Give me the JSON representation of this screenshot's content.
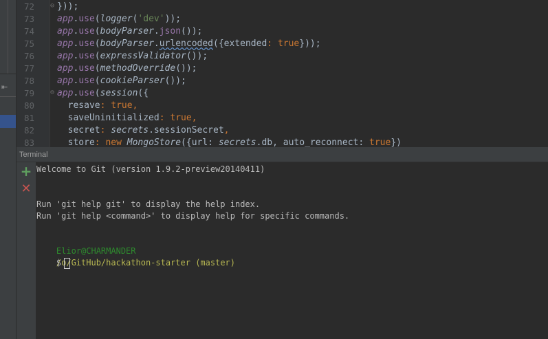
{
  "editor": {
    "lines": [
      {
        "num": "72",
        "tokens": [
          {
            "t": "})",
            "c": "plain"
          },
          {
            "t": ");",
            "c": "plain"
          }
        ]
      },
      {
        "num": "73",
        "tokens": [
          {
            "t": "app",
            "c": "obj"
          },
          {
            "t": ".",
            "c": "plain"
          },
          {
            "t": "use",
            "c": "prop"
          },
          {
            "t": "(",
            "c": "plain"
          },
          {
            "t": "logger",
            "c": "fn"
          },
          {
            "t": "(",
            "c": "plain"
          },
          {
            "t": "'dev'",
            "c": "str"
          },
          {
            "t": "));",
            "c": "plain"
          }
        ]
      },
      {
        "num": "74",
        "tokens": [
          {
            "t": "app",
            "c": "obj"
          },
          {
            "t": ".",
            "c": "plain"
          },
          {
            "t": "use",
            "c": "prop"
          },
          {
            "t": "(",
            "c": "plain"
          },
          {
            "t": "bodyParser",
            "c": "fn"
          },
          {
            "t": ".",
            "c": "plain"
          },
          {
            "t": "json",
            "c": "prop"
          },
          {
            "t": "());",
            "c": "plain"
          }
        ]
      },
      {
        "num": "75",
        "tokens": [
          {
            "t": "app",
            "c": "obj"
          },
          {
            "t": ".",
            "c": "plain"
          },
          {
            "t": "use",
            "c": "prop"
          },
          {
            "t": "(",
            "c": "plain"
          },
          {
            "t": "bodyParser",
            "c": "fn"
          },
          {
            "t": ".",
            "c": "plain"
          },
          {
            "t": "urlencoded",
            "c": "squig"
          },
          {
            "t": "({",
            "c": "plain"
          },
          {
            "t": "extended",
            "c": "plain"
          },
          {
            "t": ": ",
            "c": "kw"
          },
          {
            "t": "true",
            "c": "kw"
          },
          {
            "t": "}));",
            "c": "plain"
          }
        ]
      },
      {
        "num": "76",
        "tokens": [
          {
            "t": "app",
            "c": "obj"
          },
          {
            "t": ".",
            "c": "plain"
          },
          {
            "t": "use",
            "c": "prop"
          },
          {
            "t": "(",
            "c": "plain"
          },
          {
            "t": "expressValidator",
            "c": "fn"
          },
          {
            "t": "());",
            "c": "plain"
          }
        ]
      },
      {
        "num": "77",
        "tokens": [
          {
            "t": "app",
            "c": "obj"
          },
          {
            "t": ".",
            "c": "plain"
          },
          {
            "t": "use",
            "c": "prop"
          },
          {
            "t": "(",
            "c": "plain"
          },
          {
            "t": "methodOverride",
            "c": "fn"
          },
          {
            "t": "());",
            "c": "plain"
          }
        ]
      },
      {
        "num": "78",
        "tokens": [
          {
            "t": "app",
            "c": "obj"
          },
          {
            "t": ".",
            "c": "plain"
          },
          {
            "t": "use",
            "c": "prop"
          },
          {
            "t": "(",
            "c": "plain"
          },
          {
            "t": "cookieParser",
            "c": "fn"
          },
          {
            "t": "());",
            "c": "plain"
          }
        ]
      },
      {
        "num": "79",
        "tokens": [
          {
            "t": "app",
            "c": "obj"
          },
          {
            "t": ".",
            "c": "plain"
          },
          {
            "t": "use",
            "c": "prop"
          },
          {
            "t": "(",
            "c": "plain"
          },
          {
            "t": "session",
            "c": "fn"
          },
          {
            "t": "({",
            "c": "plain"
          }
        ]
      },
      {
        "num": "80",
        "tokens": [
          {
            "t": "  resave",
            "c": "plain"
          },
          {
            "t": ": ",
            "c": "kw"
          },
          {
            "t": "true",
            "c": "kw"
          },
          {
            "t": ",",
            "c": "kw"
          }
        ]
      },
      {
        "num": "81",
        "tokens": [
          {
            "t": "  saveUninitialized",
            "c": "plain"
          },
          {
            "t": ": ",
            "c": "kw"
          },
          {
            "t": "true",
            "c": "kw"
          },
          {
            "t": ",",
            "c": "kw"
          }
        ]
      },
      {
        "num": "82",
        "tokens": [
          {
            "t": "  secret",
            "c": "plain"
          },
          {
            "t": ": ",
            "c": "kw"
          },
          {
            "t": "secrets",
            "c": "fn"
          },
          {
            "t": ".sessionSecret",
            "c": "plain"
          },
          {
            "t": ",",
            "c": "kw"
          }
        ]
      },
      {
        "num": "83",
        "tokens": [
          {
            "t": "  store",
            "c": "plain"
          },
          {
            "t": ": ",
            "c": "kw"
          },
          {
            "t": "new ",
            "c": "kw"
          },
          {
            "t": "MongoStore",
            "c": "fn"
          },
          {
            "t": "({url: ",
            "c": "plain"
          },
          {
            "t": "secrets",
            "c": "fn"
          },
          {
            "t": ".db, auto_reconnect: ",
            "c": "plain"
          },
          {
            "t": "true",
            "c": "kw"
          },
          {
            "t": "})",
            "c": "plain"
          }
        ]
      }
    ]
  },
  "terminal": {
    "title": "Terminal",
    "add_icon": "+",
    "close_icon": "✕",
    "welcome": "Welcome to Git (version 1.9.2-preview20140411)",
    "help1": "Run 'git help git' to display the help index.",
    "help2": "Run 'git help <command>' to display help for specific commands.",
    "user": "Elior@CHARMANDER",
    "path": "/o/GitHub/hackathon-starter (master)",
    "prompt": "$"
  }
}
